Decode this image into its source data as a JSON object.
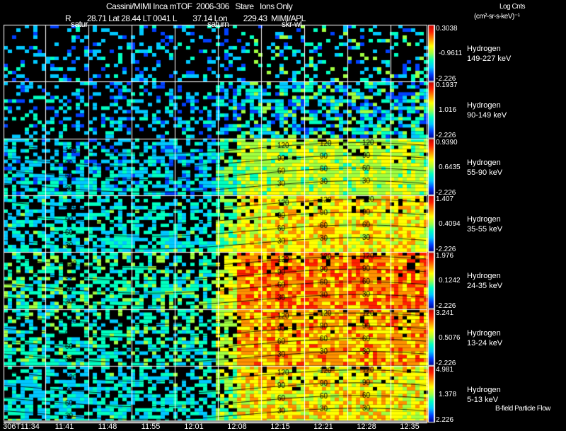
{
  "header": {
    "title": "Cassini/MIMI Inca mTOF  2006-306   Stare   Ions Only",
    "ephem": "R        28.71 Lat 28.44 LT 0041 L        37.14 Lon        229.43  MIMI/APL",
    "units_line1": "Log Cnts",
    "units_line2": "(cm²-sr-s-keV)⁻¹"
  },
  "markers": [
    "satur",
    "saturn",
    "skr-wl"
  ],
  "footer_note": "B-field Particle Flow",
  "chart_data": {
    "type": "heatmap",
    "xlabel": "",
    "x_ticks": [
      "306T11:34",
      "11:41",
      "11:48",
      "11:55",
      "12:01",
      "12:08",
      "12:15",
      "12:21",
      "12:28",
      "12:35"
    ],
    "contour_levels": [
      "30",
      "60",
      "90",
      "120"
    ],
    "grid": true,
    "colormap": [
      "#00008b",
      "#0040ff",
      "#00c8ff",
      "#00ffc0",
      "#a0ff40",
      "#ffff00",
      "#ff9000",
      "#ff2000",
      "#c00000"
    ],
    "panels": [
      {
        "species": "Hydrogen",
        "energy": "149-227 keV",
        "cmax": "0.3038",
        "cmid": "-0.9611",
        "cmin": "-2.226",
        "intensity": 0.25
      },
      {
        "species": "Hydrogen",
        "energy": "90-149 keV",
        "cmax": "0.1937",
        "cmid": "1.016",
        "cmin": "-2.226",
        "intensity": 0.35
      },
      {
        "species": "Hydrogen",
        "energy": "55-90 keV",
        "cmax": "0.9390",
        "cmid": "0.6435",
        "cmin": "-2.226",
        "intensity": 0.6
      },
      {
        "species": "Hydrogen",
        "energy": "35-55 keV",
        "cmax": "1.407",
        "cmid": "0.4094",
        "cmin": "-2.226",
        "intensity": 0.7
      },
      {
        "species": "Hydrogen",
        "energy": "24-35 keV",
        "cmax": "1.976",
        "cmid": "0.1242",
        "cmin": "-2.226",
        "intensity": 0.85
      },
      {
        "species": "Hydrogen",
        "energy": "13-24 keV",
        "cmax": "3.241",
        "cmid": "0.5076",
        "cmin": "-2.226",
        "intensity": 0.8
      },
      {
        "species": "Hydrogen",
        "energy": "5-13 keV",
        "cmax": "4.981",
        "cmid": "1.378",
        "cmin": "2.226",
        "intensity": 0.7
      }
    ]
  }
}
